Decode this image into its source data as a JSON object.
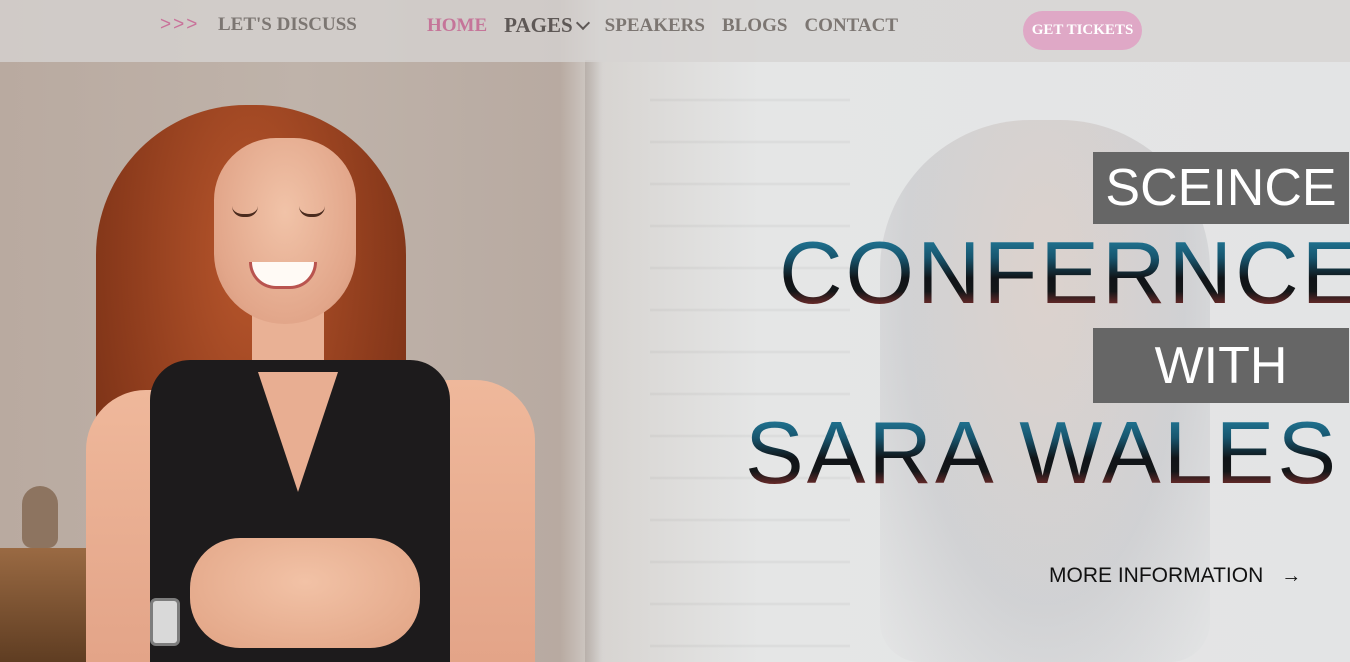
{
  "header": {
    "discuss_arrows": ">>>",
    "discuss_label": "LET'S DISCUSS",
    "nav": [
      {
        "label": "HOME"
      },
      {
        "label": "PAGES"
      },
      {
        "label": "SPEAKERS"
      },
      {
        "label": "BLOGS"
      },
      {
        "label": "CONTACT"
      }
    ],
    "tickets_label": "GET TICKETS"
  },
  "hero": {
    "line1": "SCEINCE",
    "line2": "CONFERNCE",
    "line3": "WITH",
    "line4": "SARA WALES",
    "cta_label": "MORE INFORMATION",
    "cta_icon": "→"
  },
  "colors": {
    "accent_pink": "#c57599",
    "button_pink": "#dfa8c6",
    "box_gray": "#666666"
  }
}
